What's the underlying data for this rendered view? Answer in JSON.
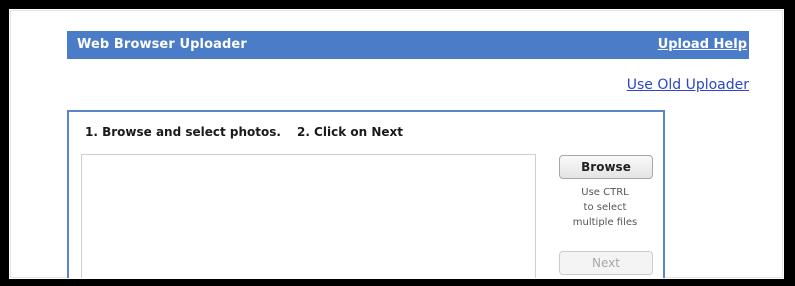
{
  "header": {
    "title": "Web Browser Uploader",
    "help_link": "Upload Help"
  },
  "old_uploader_link": "Use Old Uploader",
  "panel": {
    "step_one": "1. Browse and select photos.",
    "step_two": "2. Click on Next",
    "browse_label": "Browse",
    "hint_lines": [
      "Use CTRL",
      "to select",
      "multiple files"
    ],
    "next_label": "Next"
  },
  "colors": {
    "header_bg": "#4a7cc7",
    "link": "#2a45c9",
    "panel_border": "#5a86c9"
  }
}
